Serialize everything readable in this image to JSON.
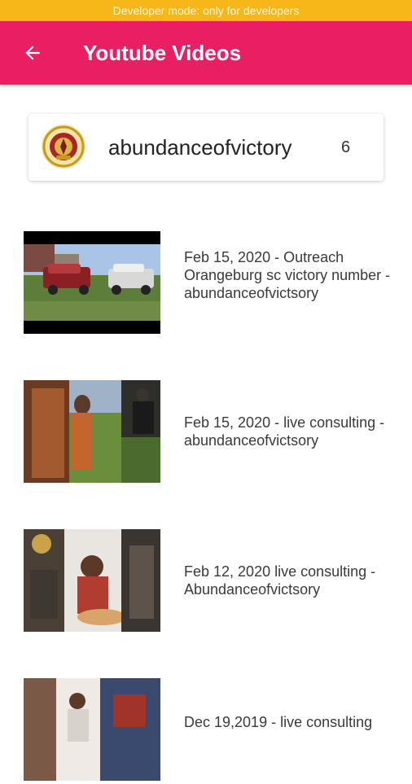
{
  "status": {
    "developer_banner": "Developer mode: only for developers"
  },
  "appbar": {
    "title": "Youtube Videos",
    "back_icon": "arrow-back-icon",
    "color": "#e91e63"
  },
  "channel": {
    "name": "abundanceofvictory",
    "count": "6"
  },
  "videos": [
    {
      "title": "Feb 15, 2020 - Outreach Orangeburg sc victory number - abundanceofvictsory"
    },
    {
      "title": "Feb 15, 2020 - live consulting - abundanceofvictsory"
    },
    {
      "title": "Feb 12, 2020 live consulting - Abundanceofvictsory"
    },
    {
      "title": "Dec 19,2019 - live consulting"
    }
  ]
}
